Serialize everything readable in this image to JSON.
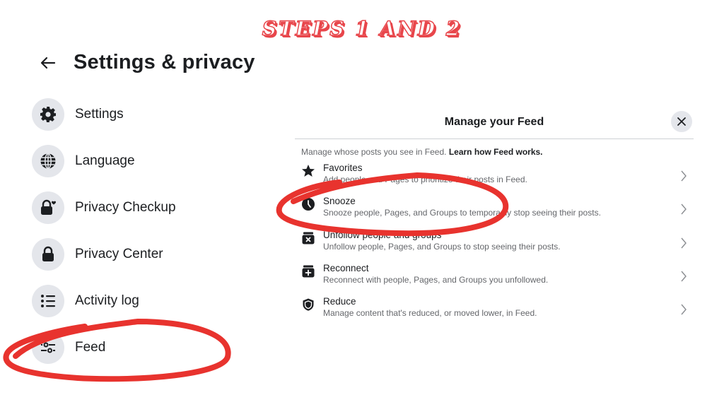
{
  "banner": {
    "text": "STEPS 1 AND 2"
  },
  "header": {
    "title": "Settings & privacy",
    "back_icon": "arrow-left-icon"
  },
  "sidebar": {
    "items": [
      {
        "label": "Settings",
        "icon": "gear-icon"
      },
      {
        "label": "Language",
        "icon": "globe-icon"
      },
      {
        "label": "Privacy Checkup",
        "icon": "lock-heart-icon"
      },
      {
        "label": "Privacy Center",
        "icon": "lock-icon"
      },
      {
        "label": "Activity log",
        "icon": "list-icon"
      },
      {
        "label": "Feed",
        "icon": "sliders-icon",
        "highlighted": true
      }
    ]
  },
  "panel": {
    "title": "Manage your Feed",
    "close_icon": "close-icon",
    "intro": "Manage whose posts you see in Feed.",
    "intro_link": "Learn how Feed works.",
    "items": [
      {
        "title": "Favorites",
        "description": "Add people and Pages to prioritize their posts in Feed.",
        "icon": "star-icon"
      },
      {
        "title": "Snooze",
        "description": "Snooze people, Pages, and Groups to temporarily stop seeing their posts.",
        "icon": "clock-icon",
        "highlighted": true
      },
      {
        "title": "Unfollow people and groups",
        "description": "Unfollow people, Pages, and Groups to stop seeing their posts.",
        "icon": "unfollow-box-icon"
      },
      {
        "title": "Reconnect",
        "description": "Reconnect with people, Pages, and Groups you unfollowed.",
        "icon": "reconnect-box-icon"
      },
      {
        "title": "Reduce",
        "description": "Manage content that's reduced, or moved lower, in Feed.",
        "icon": "shield-icon"
      }
    ]
  },
  "colors": {
    "annotation_red": "#e8332e",
    "banner_red": "#e8464b",
    "icon_bg": "#e4e6eb",
    "primary_text": "#1c1e21",
    "secondary_text": "#65676b"
  }
}
